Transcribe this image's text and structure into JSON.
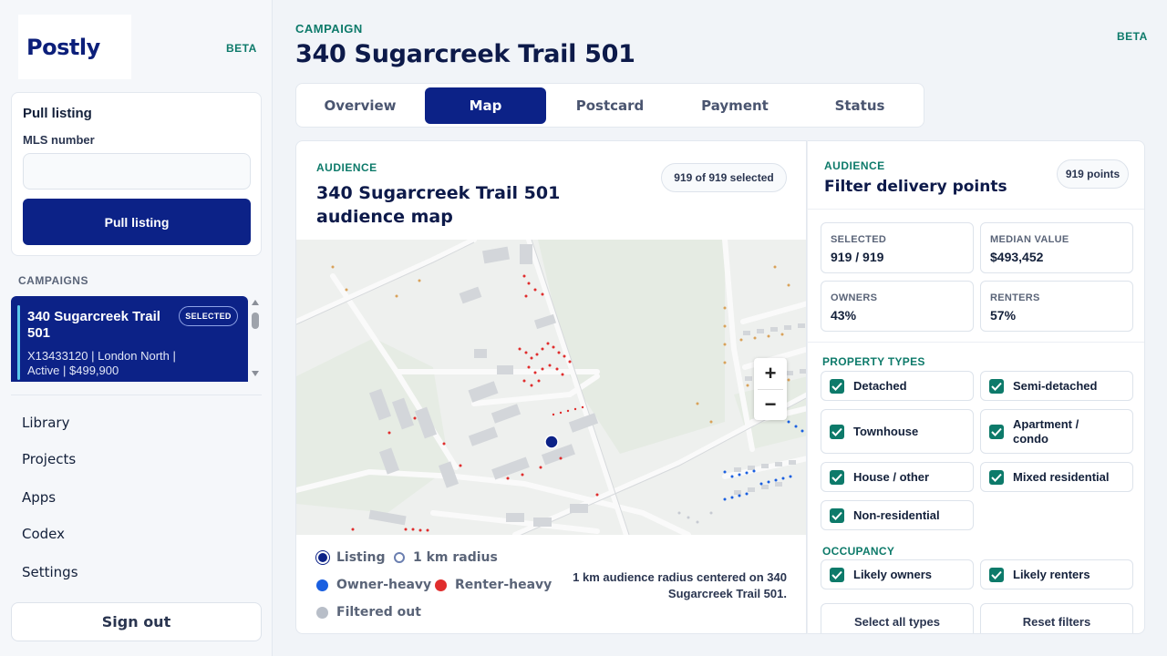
{
  "app": {
    "name": "Postly",
    "beta_label": "BETA"
  },
  "pull_listing": {
    "title": "Pull listing",
    "mls_label": "MLS number",
    "mls_value": "",
    "button_label": "Pull listing"
  },
  "sidebar": {
    "campaigns_label": "CAMPAIGNS",
    "campaigns": [
      {
        "name": "340 Sugarcreek Trail 501",
        "badge": "SELECTED",
        "meta": "X13433120 | London North | Active | $499,900"
      }
    ],
    "nav": [
      "Library",
      "Projects",
      "Apps",
      "Codex",
      "Settings"
    ],
    "signout_label": "Sign out"
  },
  "header": {
    "eyebrow": "CAMPAIGN",
    "title": "340 Sugarcreek Trail 501",
    "beta_label": "BETA",
    "tabs": [
      {
        "label": "Overview",
        "active": false
      },
      {
        "label": "Map",
        "active": true
      },
      {
        "label": "Postcard",
        "active": false
      },
      {
        "label": "Payment",
        "active": false
      },
      {
        "label": "Status",
        "active": false
      }
    ]
  },
  "map_card": {
    "eyebrow": "AUDIENCE",
    "title": "340 Sugarcreek Trail 501 audience map",
    "selected_pill": "919 of 919 selected",
    "zoom_in": "+",
    "zoom_out": "−",
    "legend": [
      {
        "label": "Listing",
        "color": "#0c2287",
        "style": "filled-ring"
      },
      {
        "label": "1 km radius",
        "color": "#6b7fb0",
        "style": "outline"
      },
      {
        "label": "Owner-heavy",
        "color": "#1a5fe0",
        "style": "filled"
      },
      {
        "label": "Renter-heavy",
        "color": "#e02d2d",
        "style": "filled"
      },
      {
        "label": "Filtered out",
        "color": "#b8bec8",
        "style": "filled"
      }
    ],
    "caption": "1 km audience radius centered on 340 Sugarcreek Trail 501."
  },
  "filters": {
    "eyebrow": "AUDIENCE",
    "title": "Filter delivery points",
    "points_pill": "919 points",
    "stats": [
      {
        "label": "SELECTED",
        "value": "919 / 919"
      },
      {
        "label": "MEDIAN VALUE",
        "value": "$493,452"
      },
      {
        "label": "OWNERS",
        "value": "43%"
      },
      {
        "label": "RENTERS",
        "value": "57%"
      }
    ],
    "property_types_label": "PROPERTY TYPES",
    "property_types": [
      {
        "label": "Detached",
        "checked": true
      },
      {
        "label": "Semi-detached",
        "checked": true
      },
      {
        "label": "Townhouse",
        "checked": true
      },
      {
        "label": "Apartment / condo",
        "checked": true
      },
      {
        "label": "House / other",
        "checked": true
      },
      {
        "label": "Mixed residential",
        "checked": true
      },
      {
        "label": "Non-residential",
        "checked": true
      }
    ],
    "occupancy_label": "OCCUPANCY",
    "occupancy": [
      {
        "label": "Likely owners",
        "checked": true
      },
      {
        "label": "Likely renters",
        "checked": true
      }
    ],
    "select_all_label": "Select all types",
    "reset_label": "Reset filters"
  },
  "colors": {
    "primary": "#0c2287",
    "accent_teal": "#0d7a6a",
    "owner_heavy": "#1a5fe0",
    "renter_heavy": "#e02d2d",
    "filtered_out": "#b8bec8"
  }
}
